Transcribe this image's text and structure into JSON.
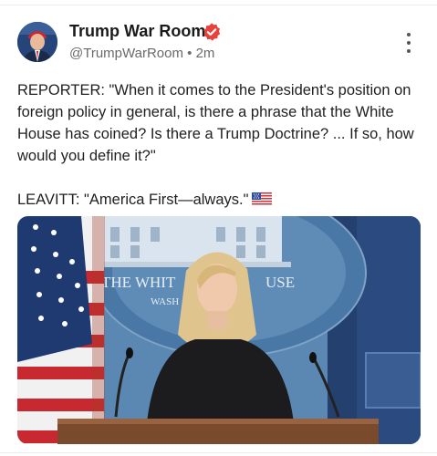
{
  "post": {
    "author_name": "Trump War Room",
    "handle": "@TrumpWarRoom",
    "separator": "•",
    "time_ago": "2m",
    "text_reporter": "REPORTER: \"When it comes to the President's position on foreign policy in general, is there a phrase that the White House has coined? Is there a Trump Doctrine? ... If so, how would you define it?\"",
    "text_leavitt": "LEAVITT: \"America First—always.\"",
    "emoji_name": "us-flag-emoji"
  },
  "media": {
    "seal_text_line1": "THE WHIT",
    "seal_text_line1_right": "USE",
    "seal_text_line2": "WASH"
  },
  "colors": {
    "verified_badge": "#e8403a",
    "backdrop_blue": "#5b88b2",
    "text_secondary": "#6a6a6a"
  }
}
